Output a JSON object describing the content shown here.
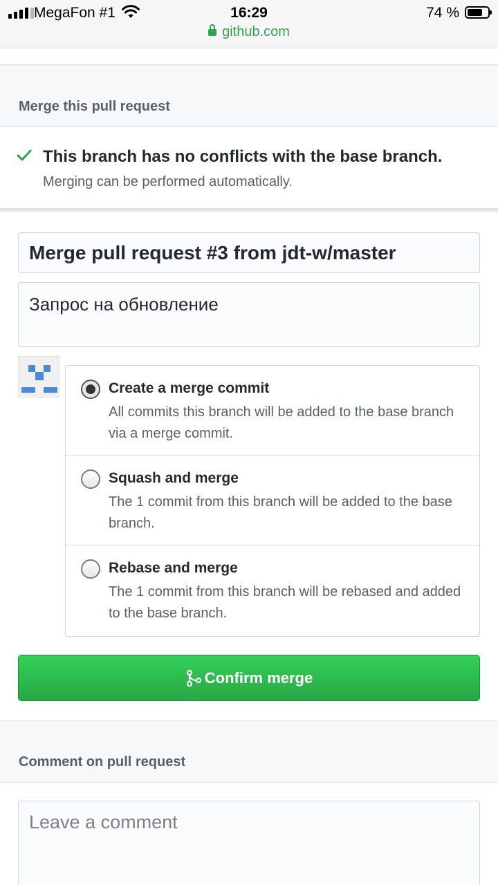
{
  "status_bar": {
    "carrier": "MegaFon #1",
    "time": "16:29",
    "battery": "74 %",
    "battery_level": 0.74,
    "url": "github.com"
  },
  "merge_section": {
    "title": "Merge this pull request",
    "status_title": "This branch has no conflicts with the base branch.",
    "status_sub": "Merging can be performed automatically.",
    "commit_title_value": "Merge pull request #3 from jdt-w/master",
    "commit_body_value": "Запрос на обновление",
    "options": [
      {
        "label": "Create a merge commit",
        "desc": "All commits this branch will be added to the base branch via a merge commit.",
        "checked": true
      },
      {
        "label": "Squash and merge",
        "desc": "The 1 commit from this branch will be added to the base branch.",
        "checked": false
      },
      {
        "label": "Rebase and merge",
        "desc": "The 1 commit from this branch will be rebased and added to the base branch.",
        "checked": false
      }
    ],
    "confirm_label": "Confirm merge"
  },
  "comment_section": {
    "title": "Comment on pull request",
    "placeholder": "Leave a comment"
  },
  "colors": {
    "success_green": "#28a745",
    "link_green": "#2ea44f",
    "avatar_blue": "#4a8cd4"
  }
}
